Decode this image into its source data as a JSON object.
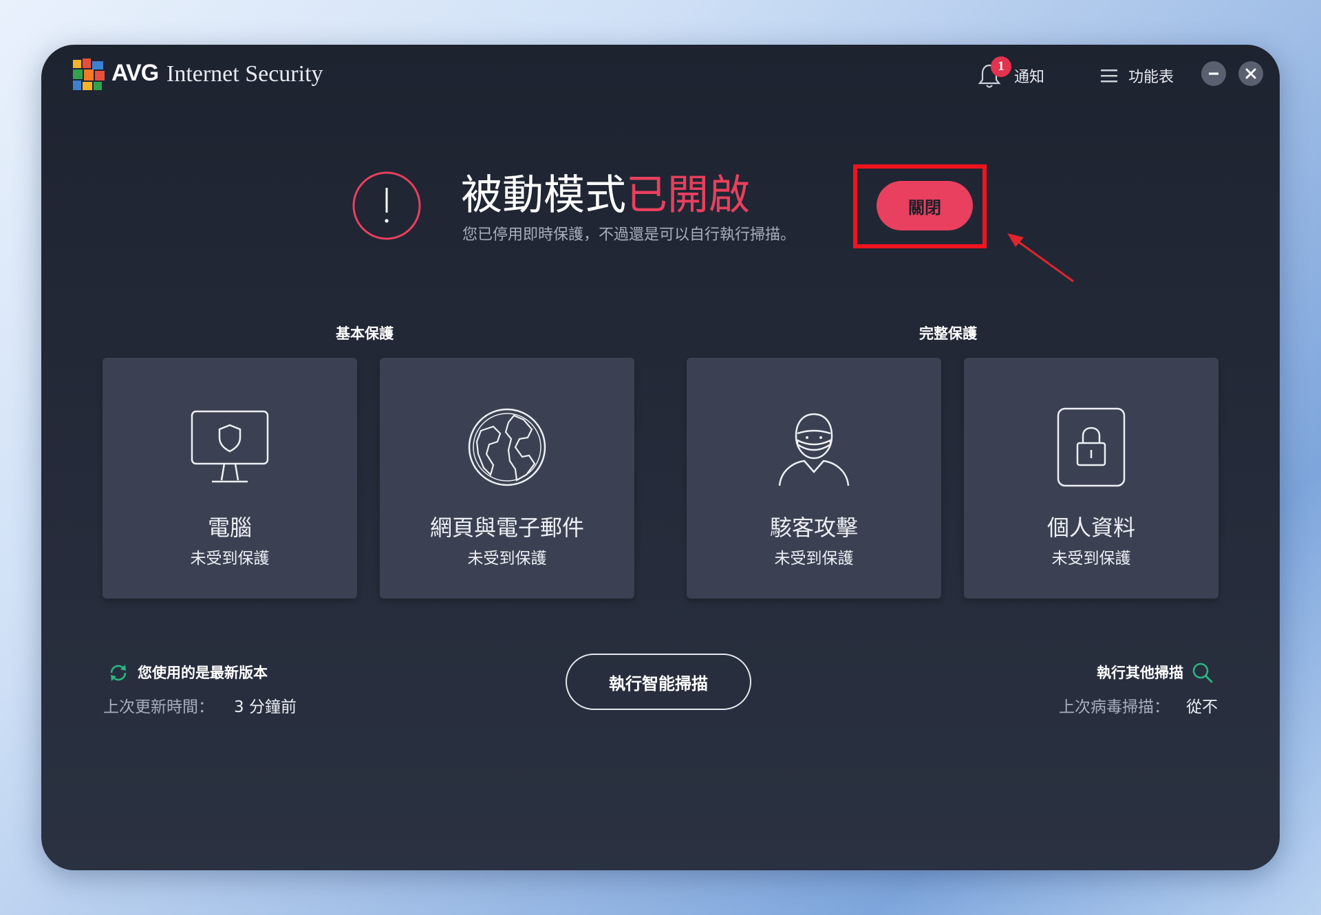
{
  "app": {
    "brand": "AVG",
    "product": "Internet Security"
  },
  "header": {
    "notification_count": "1",
    "notification_label": "通知",
    "menu_label": "功能表"
  },
  "hero": {
    "title_main": "被動模式",
    "title_highlight": "已開啟",
    "subtitle": "您已停用即時保護，不過還是可以自行執行掃描。",
    "off_button_label": "關閉"
  },
  "sections": {
    "basic_label": "基本保護",
    "full_label": "完整保護"
  },
  "cards": [
    {
      "title": "電腦",
      "status": "未受到保護",
      "icon": "computer-shield-icon"
    },
    {
      "title": "網頁與電子郵件",
      "status": "未受到保護",
      "icon": "globe-icon"
    },
    {
      "title": "駭客攻擊",
      "status": "未受到保護",
      "icon": "hacker-icon"
    },
    {
      "title": "個人資料",
      "status": "未受到保護",
      "icon": "lock-icon"
    }
  ],
  "footer": {
    "update_title": "您使用的是最新版本",
    "update_label": "上次更新時間：",
    "update_value": "3 分鐘前",
    "scan_button_label": "執行智能掃描",
    "other_scan_label": "執行其他掃描",
    "last_scan_label": "上次病毒掃描：",
    "last_scan_value": "從不"
  },
  "colors": {
    "accent": "#e8405e",
    "window_bg": "#1e2330",
    "card_bg": "#3b4152",
    "highlight_border": "#f0141e",
    "update_icon": "#2fb380"
  }
}
